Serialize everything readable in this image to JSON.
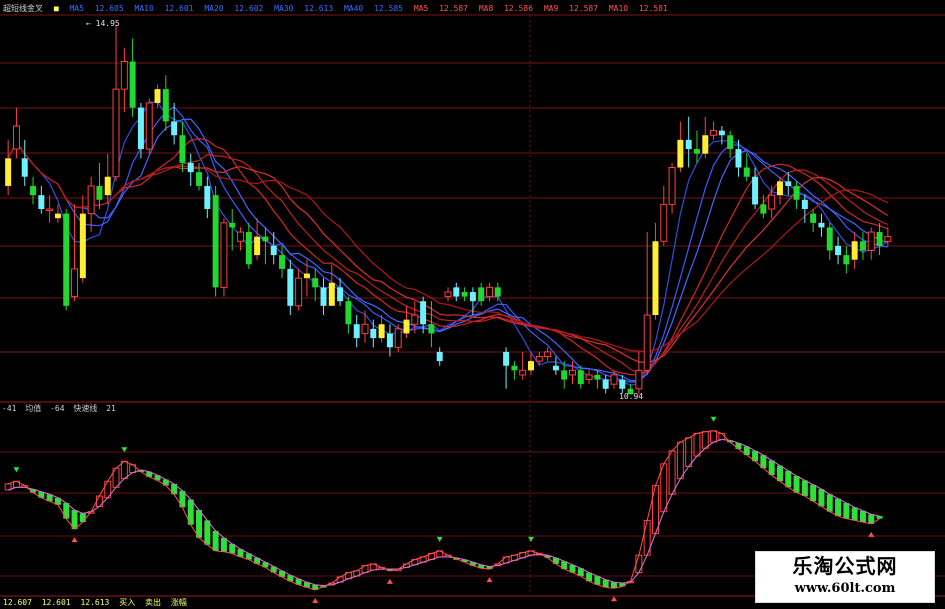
{
  "chart_data": [
    {
      "type": "candlestick",
      "panel": "main",
      "title": "超短线金叉",
      "legend_entries": [
        {
          "label": "MA5",
          "value": "12.605",
          "color": "#3c6cff"
        },
        {
          "label": "MA10",
          "value": "12.601",
          "color": "#3c6cff"
        },
        {
          "label": "MA20",
          "value": "12.602",
          "color": "#3c6cff"
        },
        {
          "label": "MA30",
          "value": "12.613",
          "color": "#3c6cff"
        },
        {
          "label": "MA40",
          "value": "12.585",
          "color": "#3c6cff"
        },
        {
          "label": "MA5",
          "value": "12.587",
          "color": "#ff5050"
        },
        {
          "label": "MA8",
          "value": "12.586",
          "color": "#ff5050"
        },
        {
          "label": "MA9",
          "value": "12.587",
          "color": "#ff5050"
        },
        {
          "label": "MA10",
          "value": "12.581",
          "color": "#ff5050"
        }
      ],
      "high_label": "14.95",
      "low_label": "10.94",
      "ylim": [
        10.9,
        15.0
      ],
      "grid": true,
      "candles": [
        [
          13.2,
          13.5,
          13.7,
          13.1
        ],
        [
          13.6,
          13.85,
          14.05,
          13.5
        ],
        [
          13.5,
          13.3,
          13.7,
          13.2
        ],
        [
          13.2,
          13.1,
          13.3,
          13.0
        ],
        [
          13.1,
          12.95,
          13.2,
          12.9
        ],
        [
          12.95,
          12.95,
          13.1,
          12.8
        ],
        [
          12.85,
          12.9,
          13.0,
          12.8
        ],
        [
          12.9,
          11.9,
          12.95,
          11.85
        ],
        [
          12.0,
          12.3,
          13.0,
          11.95
        ],
        [
          12.2,
          12.9,
          13.1,
          12.15
        ],
        [
          12.9,
          13.2,
          13.3,
          12.7
        ],
        [
          13.2,
          13.05,
          13.45,
          12.95
        ],
        [
          13.1,
          13.3,
          13.55,
          13.0
        ],
        [
          13.3,
          14.25,
          14.95,
          13.25
        ],
        [
          14.25,
          14.55,
          14.7,
          14.0
        ],
        [
          14.55,
          14.05,
          14.8,
          13.95
        ],
        [
          14.05,
          13.6,
          14.1,
          13.5
        ],
        [
          13.6,
          14.1,
          14.15,
          13.55
        ],
        [
          14.1,
          14.25,
          14.3,
          14.05
        ],
        [
          14.25,
          13.9,
          14.4,
          13.8
        ],
        [
          13.9,
          13.75,
          14.1,
          13.65
        ],
        [
          13.75,
          13.45,
          13.9,
          13.35
        ],
        [
          13.45,
          13.35,
          13.55,
          13.2
        ],
        [
          13.35,
          13.2,
          13.45,
          13.15
        ],
        [
          13.2,
          12.95,
          13.3,
          12.85
        ],
        [
          13.1,
          12.1,
          13.2,
          12.0
        ],
        [
          12.1,
          12.8,
          12.85,
          12.0
        ],
        [
          12.8,
          12.75,
          12.95,
          12.5
        ],
        [
          12.6,
          12.7,
          12.75,
          12.5
        ],
        [
          12.7,
          12.35,
          12.8,
          12.3
        ],
        [
          12.45,
          12.65,
          12.85,
          12.4
        ],
        [
          12.65,
          12.6,
          12.75,
          12.35
        ],
        [
          12.55,
          12.45,
          12.7,
          12.35
        ],
        [
          12.45,
          12.3,
          12.55,
          12.2
        ],
        [
          12.3,
          11.9,
          12.4,
          11.8
        ],
        [
          11.9,
          12.2,
          12.3,
          11.85
        ],
        [
          12.2,
          12.25,
          12.4,
          12.0
        ],
        [
          12.2,
          12.1,
          12.3,
          11.95
        ],
        [
          12.1,
          11.9,
          12.2,
          11.8
        ],
        [
          11.9,
          12.15,
          12.35,
          11.9
        ],
        [
          12.1,
          11.95,
          12.2,
          11.9
        ],
        [
          11.95,
          11.7,
          12.0,
          11.6
        ],
        [
          11.7,
          11.55,
          11.8,
          11.45
        ],
        [
          11.6,
          11.7,
          11.85,
          11.5
        ],
        [
          11.65,
          11.55,
          11.75,
          11.45
        ],
        [
          11.55,
          11.7,
          11.8,
          11.5
        ],
        [
          11.6,
          11.45,
          11.7,
          11.35
        ],
        [
          11.45,
          11.65,
          11.7,
          11.4
        ],
        [
          11.6,
          11.75,
          11.9,
          11.55
        ],
        [
          11.7,
          11.8,
          11.95,
          11.6
        ],
        [
          11.95,
          11.7,
          12.0,
          11.6
        ],
        [
          11.7,
          11.6,
          11.95,
          11.45
        ],
        [
          11.4,
          11.3,
          11.45,
          11.25
        ],
        [
          12.0,
          12.05,
          12.1,
          11.95
        ],
        [
          12.1,
          12.0,
          12.15,
          11.95
        ],
        [
          12.05,
          12.0,
          12.1,
          11.95
        ],
        [
          12.05,
          11.95,
          12.1,
          11.8
        ],
        [
          12.1,
          11.95,
          12.15,
          11.9
        ],
        [
          12.0,
          12.1,
          12.15,
          11.95
        ],
        [
          12.1,
          12.0,
          12.15,
          11.95
        ],
        [
          11.4,
          11.25,
          11.45,
          11.0
        ],
        [
          11.25,
          11.2,
          11.3,
          11.1
        ],
        [
          11.15,
          11.2,
          11.4,
          11.1
        ],
        [
          11.2,
          11.3,
          11.4,
          11.15
        ],
        [
          11.3,
          11.35,
          11.4,
          11.25
        ],
        [
          11.35,
          11.4,
          11.45,
          11.3
        ],
        [
          11.25,
          11.2,
          11.35,
          11.15
        ],
        [
          11.2,
          11.1,
          11.3,
          11.0
        ],
        [
          11.15,
          11.2,
          11.3,
          11.05
        ],
        [
          11.2,
          11.05,
          11.25,
          11.0
        ],
        [
          11.1,
          11.15,
          11.2,
          11.05
        ],
        [
          11.15,
          11.1,
          11.2,
          11.0
        ],
        [
          11.1,
          11.0,
          11.15,
          10.95
        ],
        [
          11.05,
          11.15,
          11.2,
          11.0
        ],
        [
          11.1,
          11.0,
          11.15,
          10.95
        ],
        [
          11.0,
          10.94,
          11.05,
          10.94
        ],
        [
          11.0,
          11.2,
          11.4,
          10.94
        ],
        [
          11.2,
          11.8,
          12.7,
          11.15
        ],
        [
          11.8,
          12.6,
          12.8,
          11.75
        ],
        [
          12.6,
          13.0,
          13.2,
          12.55
        ],
        [
          13.0,
          13.4,
          13.45,
          12.9
        ],
        [
          13.4,
          13.7,
          13.9,
          13.35
        ],
        [
          13.7,
          13.6,
          13.95,
          13.4
        ],
        [
          13.6,
          13.55,
          13.8,
          13.45
        ],
        [
          13.55,
          13.75,
          13.95,
          13.5
        ],
        [
          13.75,
          13.8,
          13.9,
          13.7
        ],
        [
          13.8,
          13.75,
          13.85,
          13.65
        ],
        [
          13.75,
          13.6,
          13.8,
          13.5
        ],
        [
          13.6,
          13.4,
          13.7,
          13.3
        ],
        [
          13.4,
          13.3,
          13.55,
          13.25
        ],
        [
          13.3,
          13.0,
          13.4,
          12.95
        ],
        [
          13.0,
          12.9,
          13.1,
          12.85
        ],
        [
          12.95,
          13.1,
          13.2,
          12.85
        ],
        [
          13.1,
          13.25,
          13.3,
          13.0
        ],
        [
          13.25,
          13.2,
          13.35,
          13.1
        ],
        [
          13.2,
          13.05,
          13.25,
          12.95
        ],
        [
          13.05,
          12.95,
          13.1,
          12.8
        ],
        [
          12.9,
          12.8,
          12.95,
          12.7
        ],
        [
          12.8,
          12.75,
          12.9,
          12.65
        ],
        [
          12.75,
          12.5,
          12.8,
          12.4
        ],
        [
          12.55,
          12.45,
          12.65,
          12.35
        ],
        [
          12.45,
          12.35,
          12.55,
          12.25
        ],
        [
          12.4,
          12.6,
          12.7,
          12.3
        ],
        [
          12.6,
          12.5,
          12.7,
          12.4
        ],
        [
          12.5,
          12.7,
          12.75,
          12.4
        ],
        [
          12.7,
          12.55,
          12.8,
          12.45
        ],
        [
          12.6,
          12.65,
          12.75,
          12.55
        ]
      ]
    },
    {
      "type": "line",
      "panel": "indicator",
      "legend_entries": [
        {
          "label": "",
          "value": "-41"
        },
        {
          "label": "均值",
          "value": "-64"
        },
        {
          "label": "快速线",
          "value": "21"
        }
      ],
      "bottom_legend": [
        "12.607",
        "12.601",
        "12.613",
        "买入",
        "卖出",
        "涨幅"
      ],
      "ylim": [
        -100,
        100
      ],
      "grid": true,
      "series": [
        {
          "values": [
            22,
            25,
            20,
            12,
            6,
            2,
            -2,
            -18,
            -30,
            -22,
            -10,
            8,
            25,
            40,
            48,
            44,
            36,
            30,
            26,
            20,
            10,
            -5,
            -25,
            -40,
            -48,
            -55,
            -56,
            -58,
            -62,
            -65,
            -70,
            -74,
            -80,
            -85,
            -90,
            -94,
            -97,
            -100,
            -96,
            -92,
            -85,
            -80,
            -78,
            -72,
            -70,
            -74,
            -78,
            -76,
            -70,
            -65,
            -62,
            -58,
            -55,
            -60,
            -64,
            -68,
            -72,
            -75,
            -76,
            -70,
            -62,
            -60,
            -57,
            -55,
            -58,
            -63,
            -70,
            -76,
            -80,
            -84,
            -90,
            -94,
            -97,
            -98,
            -96,
            -90,
            -60,
            -20,
            20,
            45,
            60,
            70,
            75,
            80,
            82,
            83,
            80,
            70,
            62,
            55,
            48,
            40,
            32,
            25,
            18,
            12,
            8,
            2,
            -4,
            -10,
            -15,
            -18,
            -20,
            -22,
            -24,
            -18
          ]
        },
        {
          "values": [
            15,
            18,
            18,
            16,
            13,
            10,
            6,
            0,
            -8,
            -12,
            -10,
            -4,
            6,
            18,
            28,
            35,
            38,
            36,
            32,
            27,
            22,
            14,
            4,
            -8,
            -20,
            -32,
            -40,
            -47,
            -53,
            -58,
            -63,
            -68,
            -73,
            -78,
            -83,
            -87,
            -91,
            -94,
            -95,
            -94,
            -91,
            -87,
            -84,
            -80,
            -77,
            -76,
            -76,
            -76,
            -74,
            -71,
            -68,
            -65,
            -62,
            -62,
            -63,
            -65,
            -68,
            -71,
            -73,
            -72,
            -69,
            -66,
            -63,
            -60,
            -59,
            -60,
            -63,
            -67,
            -71,
            -75,
            -80,
            -84,
            -88,
            -91,
            -92,
            -91,
            -80,
            -60,
            -35,
            -10,
            10,
            28,
            42,
            54,
            63,
            70,
            73,
            72,
            69,
            65,
            60,
            55,
            49,
            43,
            37,
            31,
            26,
            21,
            16,
            10,
            5,
            0,
            -5,
            -9,
            -13,
            -15
          ]
        }
      ]
    }
  ],
  "watermark": {
    "cn": "乐淘公式网",
    "url": "www.60lt.com"
  }
}
